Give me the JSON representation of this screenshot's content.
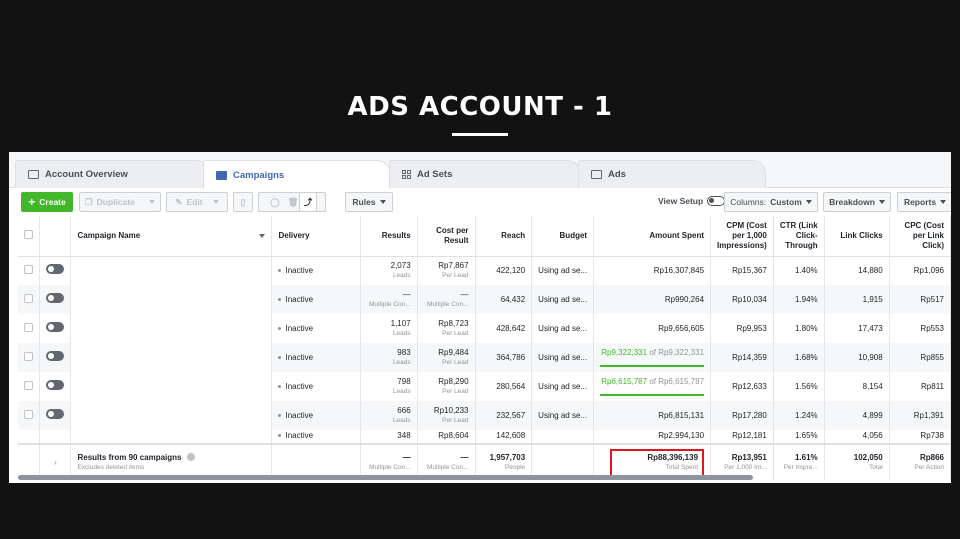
{
  "slide": {
    "title": "ADS ACCOUNT  -  1"
  },
  "tabs": [
    {
      "label": "Account Overview",
      "icon": "account-overview-icon"
    },
    {
      "label": "Campaigns",
      "icon": "campaigns-checkbox-icon"
    },
    {
      "label": "Ad Sets",
      "icon": "ad-sets-grid-icon"
    },
    {
      "label": "Ads",
      "icon": "ads-icon"
    }
  ],
  "toolbar": {
    "create": "Create",
    "duplicate": "Duplicate",
    "edit": "Edit",
    "rules": "Rules",
    "view_setup": "View Setup",
    "columns_prefix": "Columns:",
    "columns_value": "Custom",
    "breakdown": "Breakdown",
    "reports": "Reports"
  },
  "table": {
    "headers": {
      "name": "Campaign Name",
      "delivery": "Delivery",
      "results": "Results",
      "cost": "Cost per Result",
      "reach": "Reach",
      "budget": "Budget",
      "spent": "Amount Spent",
      "cpm": "CPM (Cost per 1,000 Impressions)",
      "ctr": "CTR (Link Click-Through",
      "clicks": "Link Clicks",
      "cpc": "CPC (Cost per Link Click)"
    },
    "rows": [
      {
        "delivery": "Inactive",
        "results": "2,073",
        "results_sub": "Leads",
        "cost": "Rp7,867",
        "cost_sub": "Per Lead",
        "reach": "422,120",
        "budget": "Using ad se...",
        "spent": "Rp16,307,845",
        "spent_of": "",
        "cpm": "Rp15,367",
        "ctr": "1.40%",
        "clicks": "14,880",
        "cpc": "Rp1,096"
      },
      {
        "delivery": "Inactive",
        "results": "—",
        "results_sub": "Multiple Con...",
        "cost": "—",
        "cost_sub": "Multiple Con...",
        "reach": "64,432",
        "budget": "Using ad se...",
        "spent": "Rp990,264",
        "spent_of": "",
        "cpm": "Rp10,034",
        "ctr": "1.94%",
        "clicks": "1,915",
        "cpc": "Rp517"
      },
      {
        "delivery": "Inactive",
        "results": "1,107",
        "results_sub": "Leads",
        "cost": "Rp8,723",
        "cost_sub": "Per Lead",
        "reach": "428,642",
        "budget": "Using ad se...",
        "spent": "Rp9,656,605",
        "spent_of": "",
        "cpm": "Rp9,953",
        "ctr": "1.80%",
        "clicks": "17,473",
        "cpc": "Rp553"
      },
      {
        "delivery": "Inactive",
        "results": "983",
        "results_sub": "Leads",
        "cost": "Rp9,484",
        "cost_sub": "Per Lead",
        "reach": "364,786",
        "budget": "Using ad se...",
        "spent": "Rp9,322,331",
        "spent_of": "of Rp9,322,331",
        "cpm": "Rp14,359",
        "ctr": "1.68%",
        "clicks": "10,908",
        "cpc": "Rp855"
      },
      {
        "delivery": "Inactive",
        "results": "798",
        "results_sub": "Leads",
        "cost": "Rp8,290",
        "cost_sub": "Per Lead",
        "reach": "280,564",
        "budget": "Using ad se...",
        "spent": "Rp6,615,787",
        "spent_of": "of Rp6,615,787",
        "cpm": "Rp12,633",
        "ctr": "1.56%",
        "clicks": "8,154",
        "cpc": "Rp811"
      },
      {
        "delivery": "Inactive",
        "results": "666",
        "results_sub": "Leads",
        "cost": "Rp10,233",
        "cost_sub": "Per Lead",
        "reach": "232,567",
        "budget": "Using ad se...",
        "spent": "Rp6,815,131",
        "spent_of": "",
        "cpm": "Rp17,280",
        "ctr": "1.24%",
        "clicks": "4,899",
        "cpc": "Rp1,391"
      }
    ],
    "partial_row": {
      "delivery": "Inactive",
      "results": "348",
      "cost": "Rp8,604",
      "reach": "142,608",
      "spent": "Rp2,994,130",
      "cpm": "Rp12,181",
      "ctr": "1.65%",
      "clicks": "4,056",
      "cpc": "Rp738"
    },
    "totals": {
      "label": "Results from 90 campaigns",
      "sub": "Excludes deleted items",
      "results": "—",
      "results_sub": "Multiple Con...",
      "cost": "—",
      "cost_sub": "Multiple Con...",
      "reach": "1,957,703",
      "reach_sub": "People",
      "spent": "Rp88,396,139",
      "spent_sub": "Total Spent",
      "cpm": "Rp13,951",
      "cpm_sub": "Per 1,000 Im...",
      "ctr": "1.61%",
      "ctr_sub": "Per Impre...",
      "clicks": "102,050",
      "clicks_sub": "Total",
      "cpc": "Rp866",
      "cpc_sub": "Per Action"
    }
  },
  "colors": {
    "create_green": "#42b72a",
    "active_tab_blue": "#4267b2",
    "highlight_red": "#e0161f"
  }
}
